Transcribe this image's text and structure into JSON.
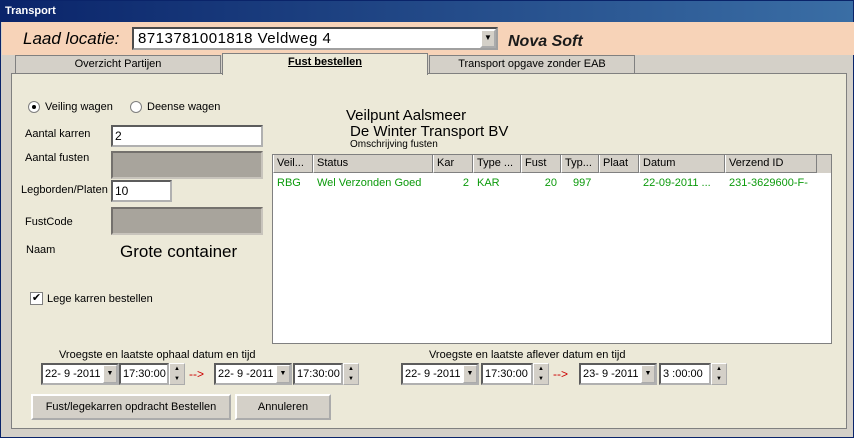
{
  "window": {
    "title": "Transport"
  },
  "header": {
    "laad_label": "Laad locatie:",
    "location_value": "8713781001818  Veldweg  4",
    "brand": "Nova Soft"
  },
  "tabs": [
    {
      "label": "Overzicht Partijen"
    },
    {
      "label": "Fust bestellen"
    },
    {
      "label": "Transport opgave zonder EAB"
    }
  ],
  "form": {
    "radio_veiling": "Veiling wagen",
    "radio_deense": "Deense wagen",
    "aantal_karren_label": "Aantal karren",
    "aantal_karren_value": "2",
    "aantal_fusten_label": "Aantal fusten",
    "legborden_label": "Legborden/Platen",
    "legborden_value": "10",
    "fustcode_label": "FustCode",
    "naam_label": "Naam",
    "naam_value": "Grote container",
    "lege_karren_label": "Lege karren bestellen",
    "check_mark": "✔"
  },
  "info": {
    "veilpunt": "Veilpunt Aalsmeer",
    "transporter": "De Winter Transport BV",
    "omschrijving": "Omschrijving fusten"
  },
  "grid": {
    "columns": [
      "Veil...",
      "Status",
      "Kar",
      "Type ...",
      "Fust",
      "Typ...",
      "Plaat",
      "Datum",
      "Verzend ID"
    ],
    "rows": [
      [
        "RBG",
        "Wel Verzonden Goed",
        "2",
        "KAR",
        "20",
        "997",
        "",
        "22-09-2011 ...",
        "231-3629600-F-"
      ]
    ],
    "row_color": "#0b9a0b"
  },
  "ophaal": {
    "label": "Vroegste en laatste ophaal datum en tijd",
    "date_from": "22- 9 -2011",
    "time_from": "17:30:00",
    "date_to": "22- 9 -2011",
    "time_to": "17:30:00",
    "arrow": "-->"
  },
  "aflever": {
    "label": "Vroegste en laatste aflever datum en tijd",
    "date_from": "22- 9 -2011",
    "time_from": "17:30:00",
    "date_to": "23- 9 -2011",
    "time_to": "3 :00:00",
    "arrow": "-->"
  },
  "buttons": {
    "order": "Fust/legekarren opdracht Bestellen",
    "cancel": "Annuleren"
  }
}
